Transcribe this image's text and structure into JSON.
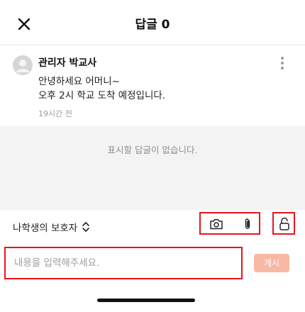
{
  "header": {
    "title": "답글 0",
    "close_icon": "close-icon"
  },
  "post": {
    "author": "관리자 박교사",
    "body_lines": [
      "안녕하세요 어머니~",
      "오후 2시 학교 도착 예정입니다."
    ],
    "time": "19시간 전",
    "more_icon": "more-vertical-icon"
  },
  "replies": {
    "empty_text": "표시할 답글이 없습니다."
  },
  "composer": {
    "author_select": "나학생의 보호자",
    "author_select_icon": "chevron-up-down-icon",
    "camera_icon": "camera-icon",
    "attach_icon": "paperclip-icon",
    "lock_icon": "unlock-icon",
    "input_value": "",
    "input_placeholder": "내용을 입력해주세요.",
    "submit_label": "게시"
  },
  "colors": {
    "highlight_border": "#e8151c",
    "submit_button": "#f8b8a4",
    "empty_area_bg": "#f3f3f3"
  }
}
